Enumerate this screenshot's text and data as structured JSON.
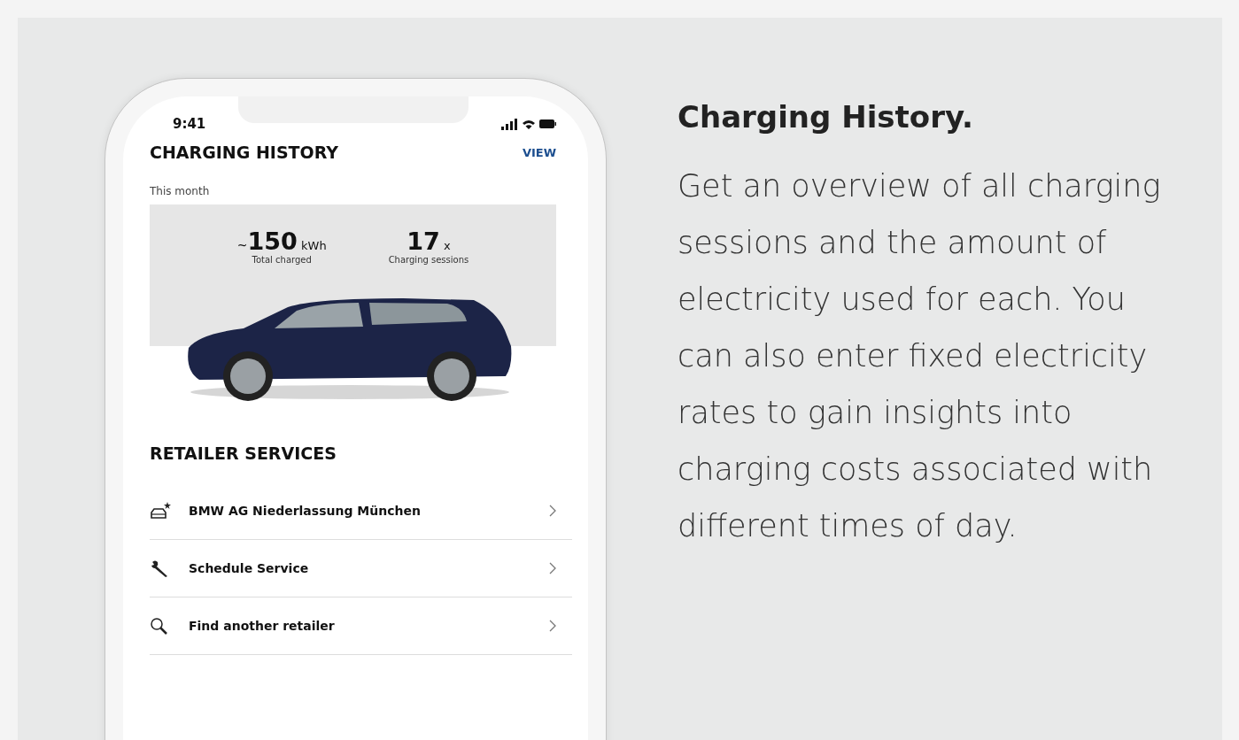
{
  "phone": {
    "status_bar": {
      "time": "9:41"
    },
    "header": {
      "title": "CHARGING HISTORY",
      "action": "VIEW"
    },
    "period": "This month",
    "stats": [
      {
        "prefix": "~",
        "value": "150",
        "unit": "kWh",
        "label": "Total charged"
      },
      {
        "value": "17",
        "unit": "x",
        "label": "Charging sessions"
      }
    ],
    "section_title": "RETAILER SERVICES",
    "services": [
      {
        "kind": "retailer",
        "label": "BMW AG Niederlassung München"
      },
      {
        "kind": "service",
        "label": "Schedule Service"
      },
      {
        "kind": "search",
        "label": "Find another retailer"
      }
    ]
  },
  "feature": {
    "title": "Charging History.",
    "description": "Get an overview of all charging sessions and the amount of electricity used for each. You can also enter fixed electricity rates to gain insights into charging costs associated with different times of day."
  }
}
